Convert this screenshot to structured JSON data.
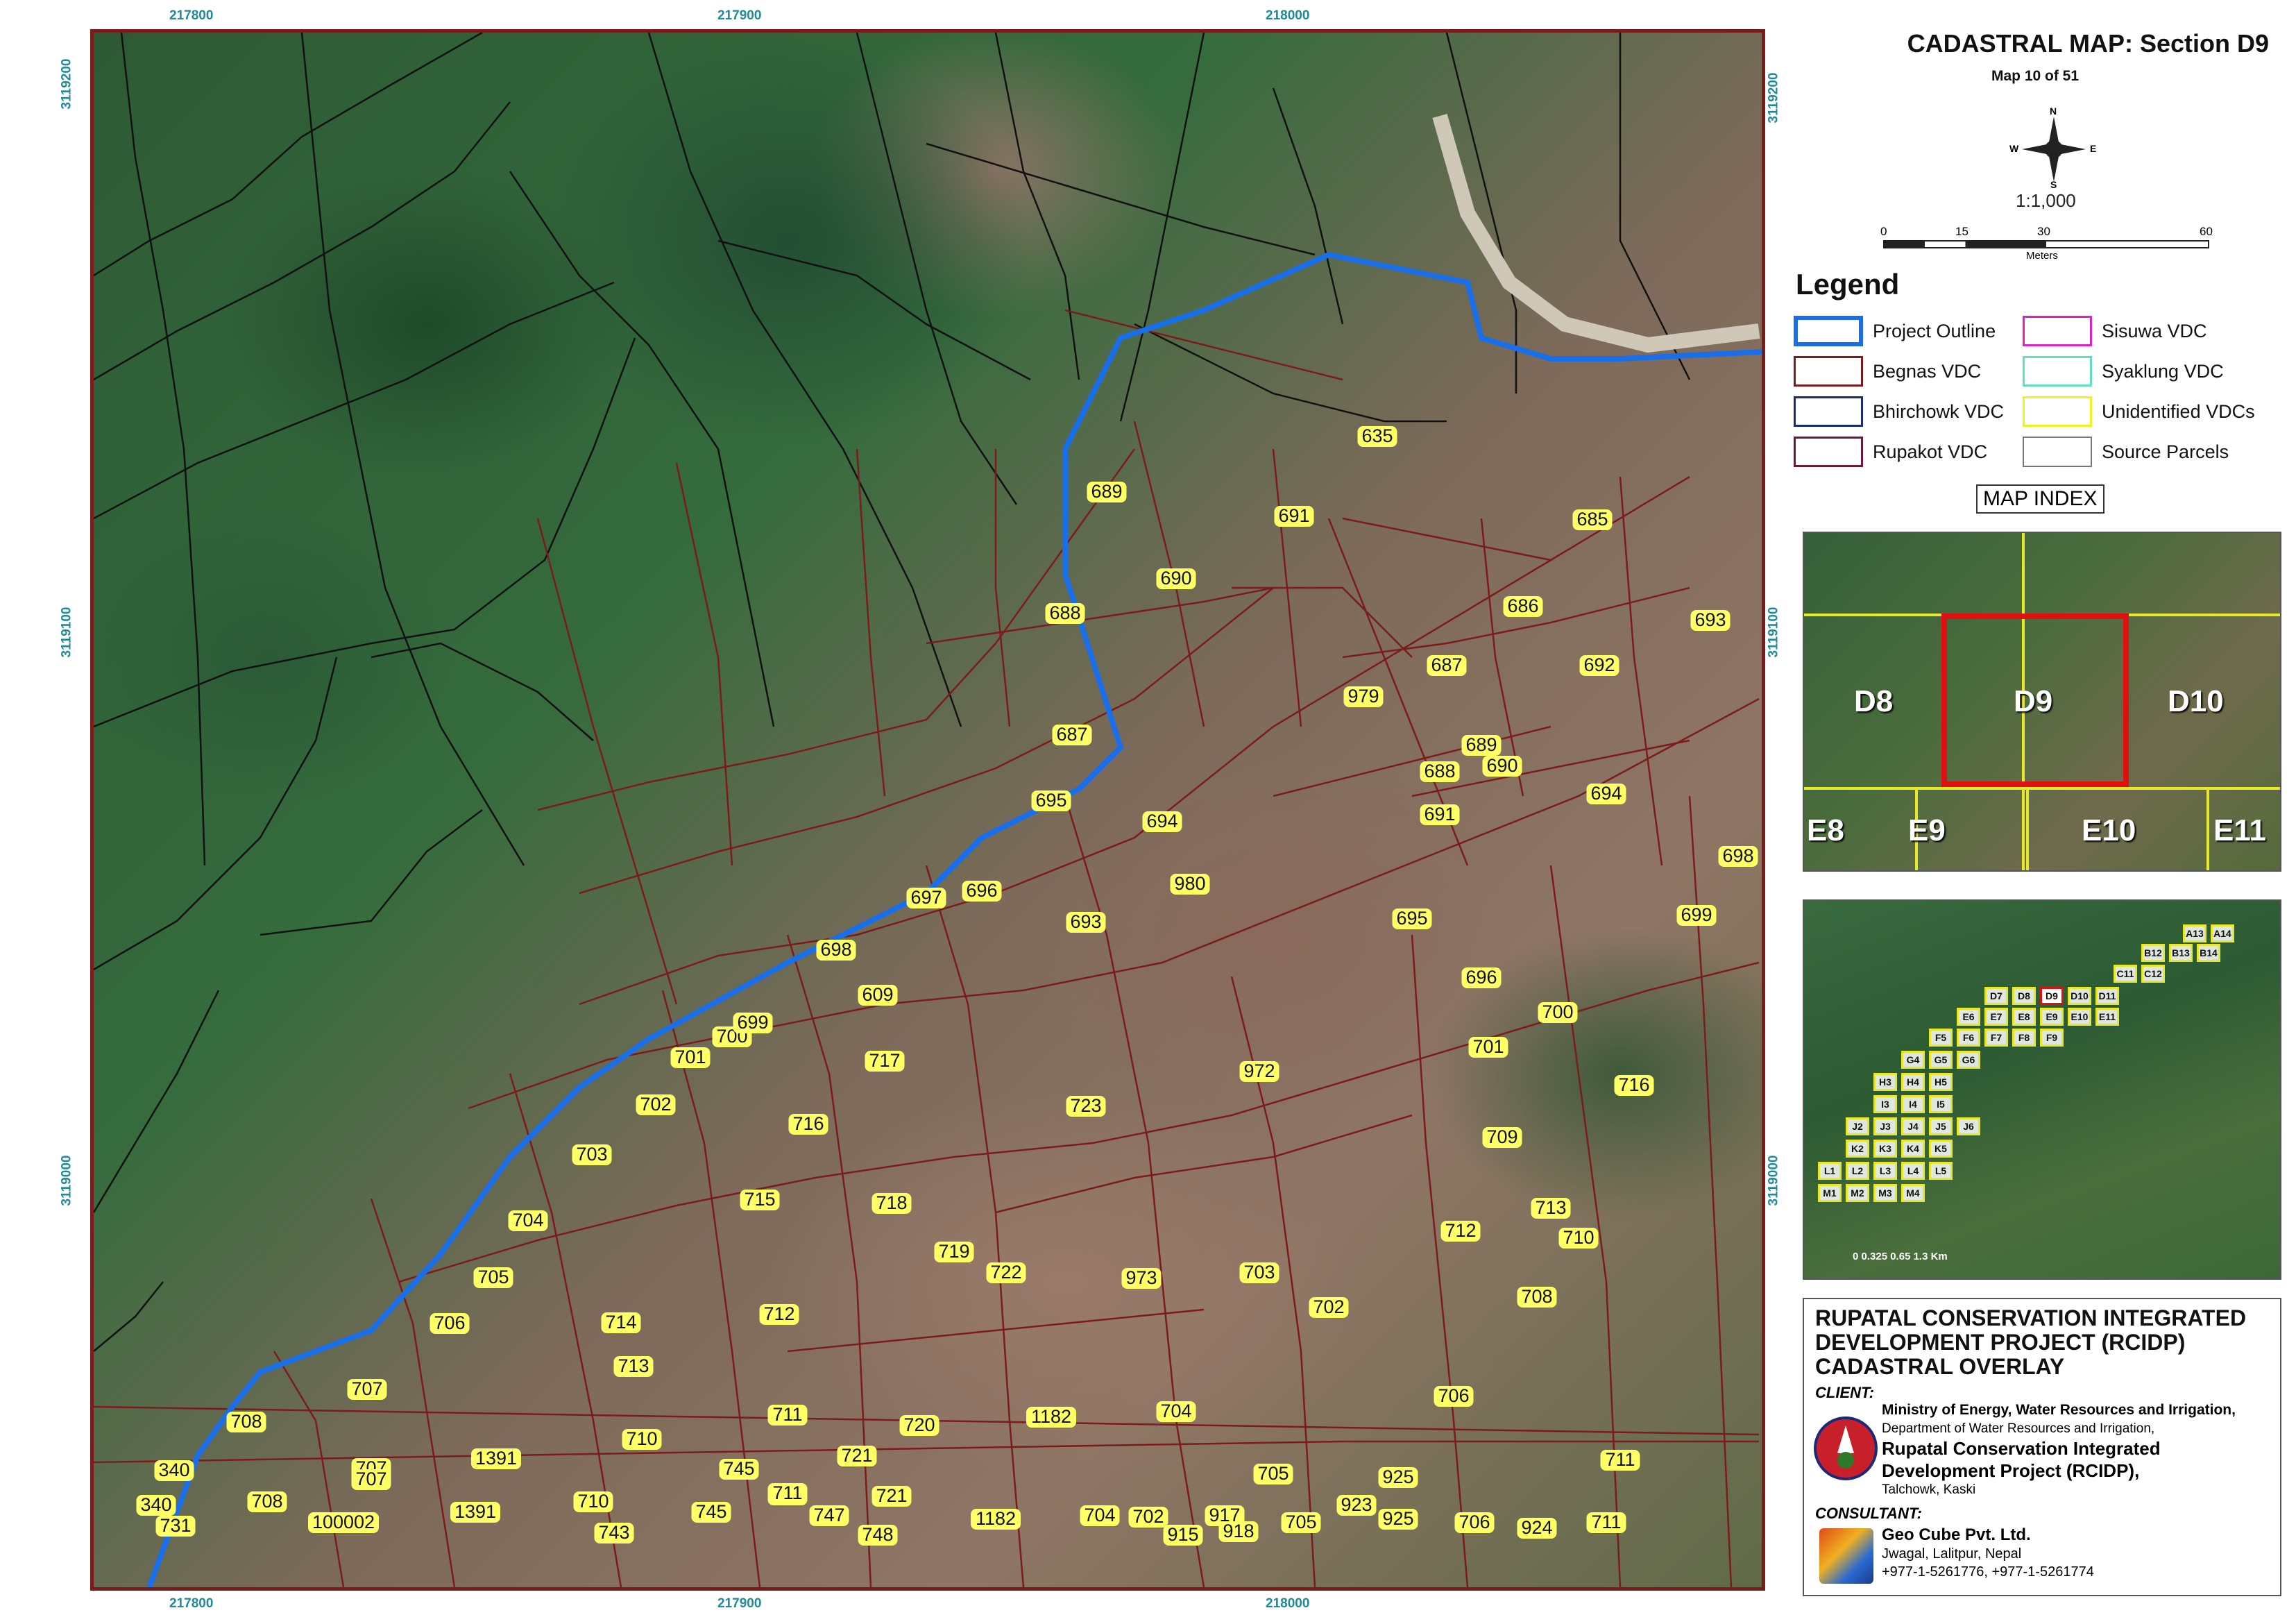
{
  "map": {
    "top_coords": [
      "217800",
      "217900",
      "218000"
    ],
    "bottom_coords": [
      "217800",
      "217900",
      "218000"
    ],
    "left_coords": [
      "3119200",
      "3119100",
      "3119000"
    ],
    "right_coords": [
      "3119200",
      "3119100",
      "3119000"
    ],
    "parcels": [
      "689",
      "635",
      "691",
      "685",
      "690",
      "686",
      "688",
      "693",
      "687",
      "692",
      "979",
      "687",
      "688",
      "689",
      "690",
      "694",
      "691",
      "695",
      "694",
      "698",
      "697",
      "696",
      "693",
      "980",
      "699",
      "698",
      "695",
      "609",
      "696",
      "700",
      "700",
      "699",
      "701",
      "717",
      "972",
      "701",
      "702",
      "723",
      "716",
      "716",
      "703",
      "709",
      "704",
      "715",
      "718",
      "712",
      "713",
      "719",
      "722",
      "973",
      "710",
      "705",
      "712",
      "703",
      "702",
      "708",
      "706",
      "714",
      "707",
      "707",
      "713",
      "708",
      "711",
      "720",
      "1182",
      "704",
      "706",
      "710",
      "721",
      "340",
      "1391",
      "707",
      "745",
      "711",
      "705",
      "925",
      "711",
      "340",
      "708",
      "1391",
      "100002",
      "710",
      "745",
      "711",
      "721",
      "747",
      "1182",
      "704",
      "702",
      "917",
      "923",
      "925",
      "706",
      "924",
      "711",
      "731",
      "743",
      "748",
      "915",
      "918",
      "705"
    ],
    "colors": {
      "project_outline": "#1a6fe8",
      "begnas": "#7a1c1c",
      "parcel_label_bg": "#ffff66"
    }
  },
  "header": {
    "title": "CADASTRAL MAP: Section D9",
    "subtitle": "Map 10 of 51"
  },
  "north_arrow": {
    "n": "N",
    "s": "S",
    "e": "E",
    "w": "W"
  },
  "scale": {
    "ratio": "1:1,000",
    "ticks": [
      "0",
      "15",
      "30",
      "60"
    ],
    "unit": "Meters"
  },
  "legend": {
    "title": "Legend",
    "items": [
      {
        "label": "Project Outline",
        "color": "#1a6fe8"
      },
      {
        "label": "Sisuwa VDC",
        "color": "#e020c8"
      },
      {
        "label": "Begnas VDC",
        "color": "#7a1c1c"
      },
      {
        "label": "Syaklung VDC",
        "color": "#60e0c0"
      },
      {
        "label": "Bhirchowk VDC",
        "color": "#1a2a7a"
      },
      {
        "label": "Unidentified VDCs",
        "color": "#f0f020"
      },
      {
        "label": "Rupakot VDC",
        "color": "#6a1a3a"
      },
      {
        "label": "Source Parcels",
        "color": "#777777"
      }
    ]
  },
  "index": {
    "label": "MAP INDEX",
    "tiles": [
      "D8",
      "D9",
      "D10",
      "E8",
      "E9",
      "E10",
      "E11"
    ],
    "mini_tiles": [
      "A13",
      "A14",
      "B12",
      "B13",
      "B14",
      "C11",
      "C12",
      "D7",
      "D8",
      "D9",
      "D10",
      "D11",
      "E6",
      "E7",
      "E8",
      "E9",
      "E10",
      "E11",
      "F5",
      "F6",
      "F7",
      "F8",
      "F9",
      "G4",
      "G5",
      "G6",
      "H3",
      "H4",
      "H5",
      "I3",
      "I4",
      "I5",
      "J2",
      "J3",
      "J4",
      "J5",
      "J6",
      "K2",
      "K3",
      "K4",
      "K5",
      "L1",
      "L2",
      "L3",
      "L4",
      "L5",
      "M1",
      "M2",
      "M3",
      "M4"
    ],
    "mini_scale": "0 0.325 0.65  1.3 Km"
  },
  "project": {
    "title": "RUPATAL CONSERVATION INTEGRATED DEVELOPMENT PROJECT (RCIDP) CADASTRAL OVERLAY",
    "client_label": "CLIENT:",
    "client_line1": "Ministry of Energy, Water Resources and Irrigation,",
    "client_line2": "Department of Water Resources and Irrigation,",
    "client_line3": "Rupatal Conservation Integrated",
    "client_line4": "Development Project (RCIDP),",
    "client_line5": "Talchowk, Kaski",
    "consultant_label": "CONSULTANT:",
    "consultant_name": "Geo Cube Pvt. Ltd.",
    "consultant_addr": "Jwagal, Lalitpur, Nepal",
    "consultant_phone": "+977-1-5261776, +977-1-5261774"
  }
}
